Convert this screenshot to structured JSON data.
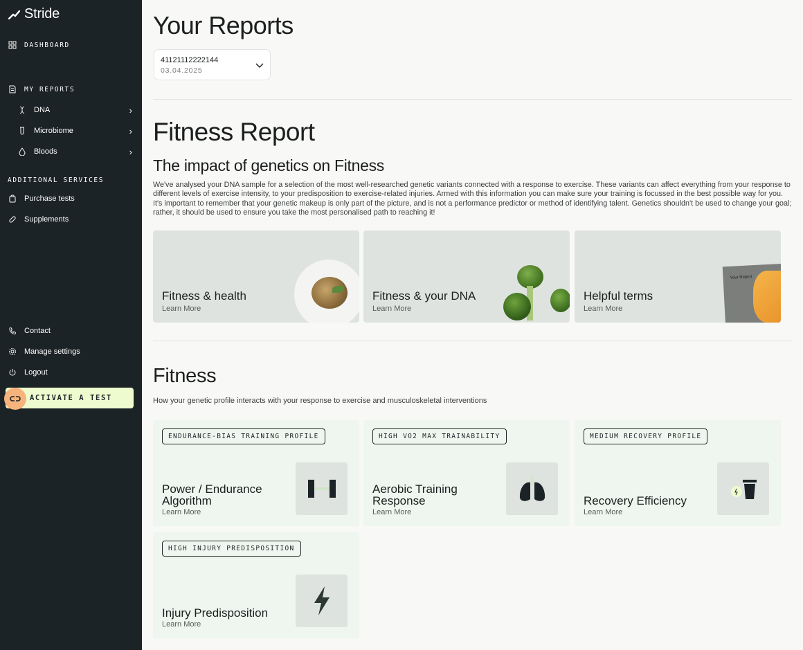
{
  "app": {
    "name": "Stride"
  },
  "sidebar": {
    "dashboard": "DASHBOARD",
    "my_reports": "MY REPORTS",
    "report_items": [
      {
        "label": "DNA",
        "icon": "dna-icon"
      },
      {
        "label": "Microbiome",
        "icon": "test-tube-icon"
      },
      {
        "label": "Bloods",
        "icon": "blood-drop-icon"
      }
    ],
    "additional_services": "ADDITIONAL SERVICES",
    "services": [
      {
        "label": "Purchase tests",
        "icon": "bag-icon"
      },
      {
        "label": "Supplements",
        "icon": "pill-icon"
      }
    ],
    "footer": [
      {
        "label": "Contact",
        "icon": "phone-icon"
      },
      {
        "label": "Manage settings",
        "icon": "gear-icon"
      },
      {
        "label": "Logout",
        "icon": "power-icon"
      }
    ],
    "activate": "ACTIVATE A TEST"
  },
  "main": {
    "title": "Your Reports",
    "report_selector": {
      "id": "41121112222144",
      "date": "03.04.2025"
    },
    "report_title": "Fitness Report",
    "subtitle": "The impact of genetics on Fitness",
    "intro": "We've analysed your DNA sample for a selection of the most well-researched genetic variants connected with a response to exercise. These variants can affect everything from your response to different levels of exercise intensity, to your predisposition to exercise-related injuries. Armed with this information you can make sure your training is focussed in the best possible way for you. It's important to remember that your genetic makeup is only part of the picture, and is not a performance predictor or method of identifying talent. Genetics shouldn't be used to change your goal; rather, it should be used to ensure you take the most personalised path to reaching it!",
    "info_cards": [
      {
        "title": "Fitness & health",
        "more": "Learn More"
      },
      {
        "title": "Fitness & your DNA",
        "more": "Learn More"
      },
      {
        "title": "Helpful terms",
        "more": "Learn More",
        "image_text": "Your Report"
      }
    ],
    "section_title": "Fitness",
    "section_sub": "How your genetic profile interacts with your response to exercise and musculoskeletal interventions",
    "traits": [
      {
        "badge": "ENDURANCE-BIAS TRAINING PROFILE",
        "title": "Power / Endurance Algorithm",
        "more": "Learn More",
        "icon": "dumbbell-icon"
      },
      {
        "badge": "HIGH VO2 MAX TRAINABILITY",
        "title": "Aerobic Training Response",
        "more": "Learn More",
        "icon": "lungs-icon"
      },
      {
        "badge": "MEDIUM RECOVERY PROFILE",
        "title": "Recovery Efficiency",
        "more": "Learn More",
        "icon": "cup-icon"
      },
      {
        "badge": "HIGH INJURY PREDISPOSITION",
        "title": "Injury Predisposition",
        "more": "Learn More",
        "icon": "lightning-icon"
      }
    ]
  },
  "colors": {
    "sidebar": "#1c2326",
    "accent": "#eefbcf",
    "accent_circle": "#f6b37c",
    "card": "#dfe3e0",
    "trait_card": "#eff6f0"
  }
}
